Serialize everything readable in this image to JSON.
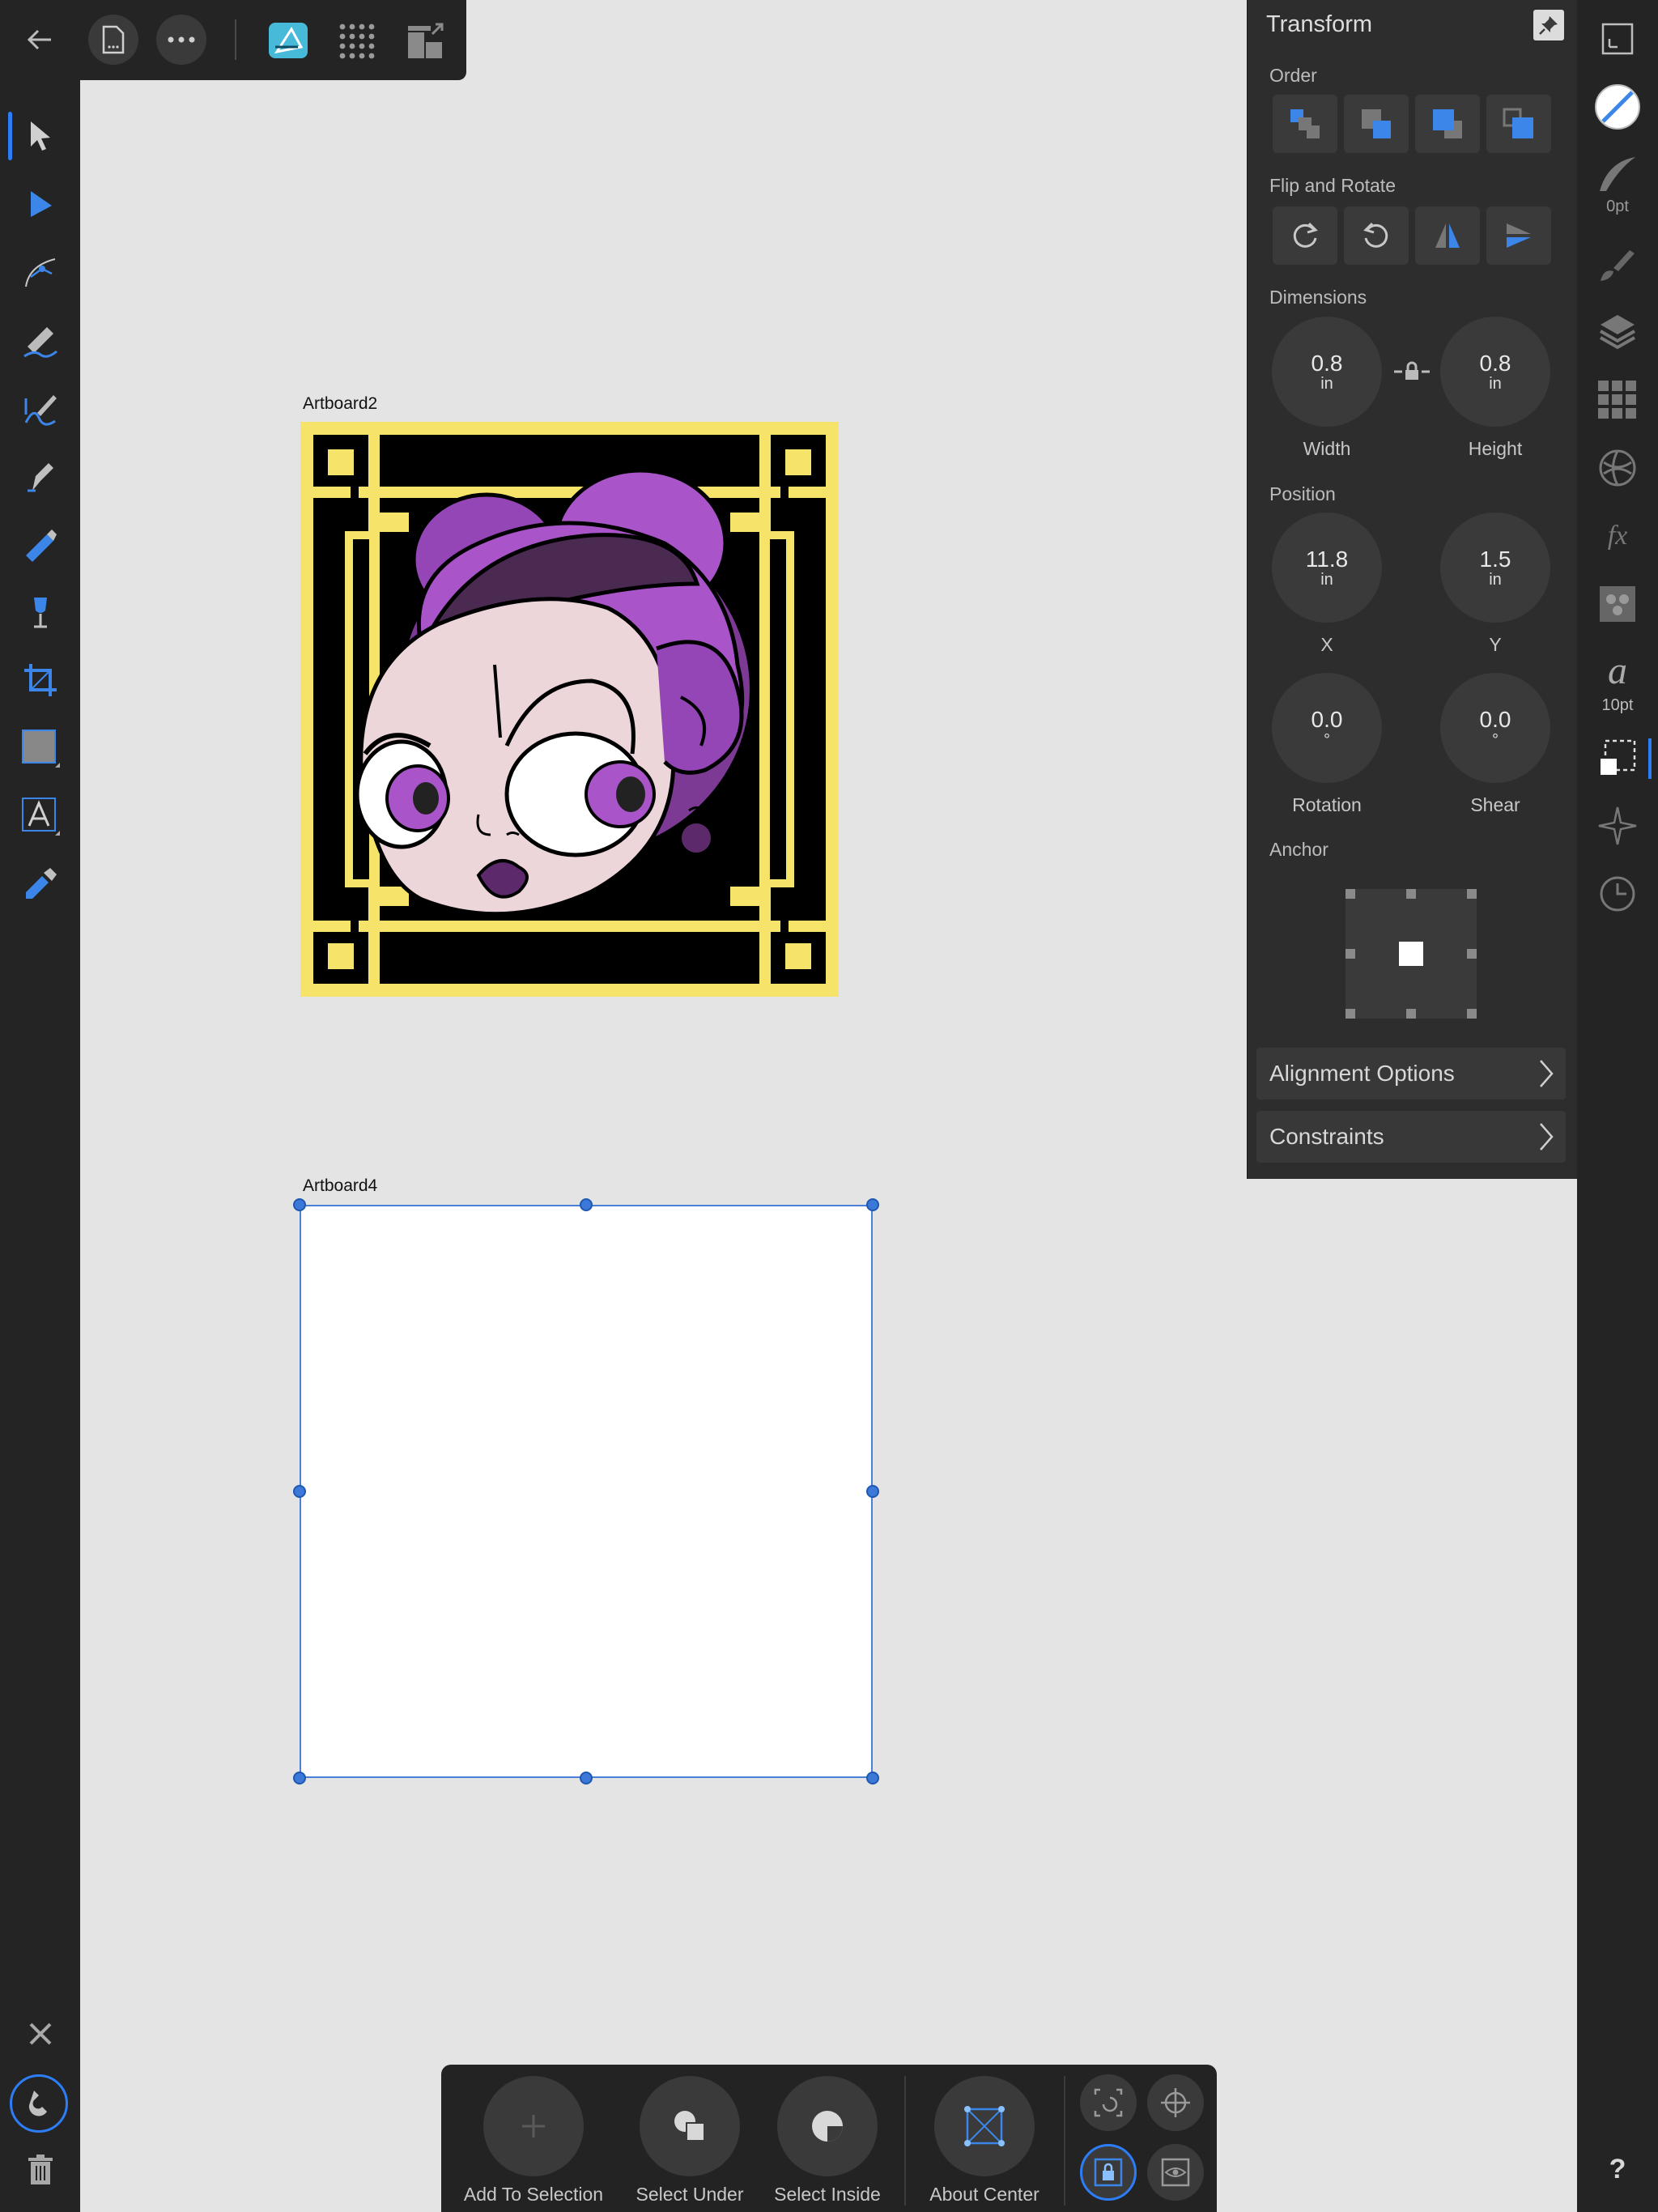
{
  "colors": {
    "accent": "#2d7df6",
    "panel": "#2d2d2d",
    "toolbar": "#242424",
    "canvas": "#e4e4e4",
    "selection": "#3b78d8"
  },
  "top_bar": {
    "icons": [
      "back-arrow-icon",
      "document-icon",
      "more-icon",
      "affinity-designer-logo",
      "grid-icon",
      "export-persona-icon"
    ]
  },
  "tools": [
    "move-tool-icon",
    "node-tool-icon",
    "corner-tool-icon",
    "pencil-tool-icon",
    "vector-brush-tool-icon",
    "pen-tool-icon",
    "fill-tool-icon",
    "transparency-tool-icon",
    "crop-tool-icon",
    "shape-tool-icon",
    "text-tool-icon",
    "color-picker-tool-icon"
  ],
  "canvas": {
    "artboard2": {
      "label": "Artboard2"
    },
    "artboard4": {
      "label": "Artboard4"
    }
  },
  "transform": {
    "title": "Transform",
    "order_label": "Order",
    "flip_label": "Flip and Rotate",
    "dimensions_label": "Dimensions",
    "width": {
      "value": "0.8",
      "unit": "in",
      "caption": "Width"
    },
    "height": {
      "value": "0.8",
      "unit": "in",
      "caption": "Height"
    },
    "position_label": "Position",
    "x": {
      "value": "11.8",
      "unit": "in",
      "caption": "X"
    },
    "y": {
      "value": "1.5",
      "unit": "in",
      "caption": "Y"
    },
    "rotation": {
      "value": "0.0",
      "unit": "°",
      "caption": "Rotation"
    },
    "shear": {
      "value": "0.0",
      "unit": "°",
      "caption": "Shear"
    },
    "anchor_label": "Anchor",
    "alignment_options": "Alignment Options",
    "constraints": "Constraints"
  },
  "right_strip": {
    "stroke_width": "0pt",
    "text_size": "10pt",
    "help": "?"
  },
  "context_bar": {
    "add_to_selection": "Add To Selection",
    "select_under": "Select Under",
    "select_inside": "Select Inside",
    "about_center": "About Center"
  }
}
